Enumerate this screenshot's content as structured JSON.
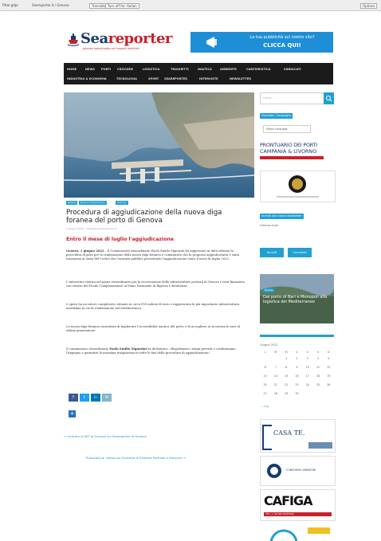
{
  "browser_bar": {
    "left_text": "Filter.gdpr",
    "middle_text": "Seareporter.it / Genova",
    "btn1": "Translate",
    "btn2": "Turn off for: Italian",
    "right_btn": "Options"
  },
  "logo": {
    "part1": "Sea",
    "part2": "reporter",
    "tagline": "giornale specializzato nei trasporti marittimi"
  },
  "banner": {
    "line1": "La tua pubblicità sul nostro sito?",
    "line2": "CLICCA QUI!"
  },
  "nav": {
    "row1": [
      "HOME",
      "NEWS",
      "PORTI",
      "CROCIERE",
      "LOGISTICA",
      "TRAGHETTI",
      "NAUTICA",
      "AMBIENTE",
      "CANTIERISTICA",
      "SINDACATI"
    ],
    "row2": [
      "INDUSTRIA & ECONOMIA",
      "TECNOLOGIA",
      "SPORT",
      "SEAREPORTER",
      "INTERVISTE",
      "NEWSLETTER"
    ]
  },
  "article": {
    "tags": [
      "Notizie",
      "Porti e infrastrutture",
      "Genova"
    ],
    "title": "Procedura di aggiudicazione della nuova diga foranea del porto di Genova",
    "meta": "2 Giugno 2022  •  Redazione Seareporter.it",
    "subtitle": "Entro il mese di luglio l'aggiudicazione",
    "p1_lead": "Genova, 1 giugno 2022",
    "p1": " – Il Commissario straordinario Paolo Emilio Signorini ha aggiornato in data odierna la procedura di gara per la realizzazione della nuova diga foranea e comunicato che la proposta aggiudicataria è stata trasmessa ai sensi del Codice dei Contratti pubblici prevedendo l'aggiudicazione entro il mese di luglio 2022.",
    "p2": "L'intervento rientra nel piano straordinario per la ricostruzione delle infrastrutture portuali di Genova e sarà finanziato con risorse del Fondo Complementare al Piano Nazionale di Ripresa e Resilienza.",
    "p3": "L'opera ha un valore complessivo stimato in circa 950 milioni di euro e rappresenta la più importante infrastruttura marittima in via di realizzazione nel Mediterraneo.",
    "p4": "La nuova diga foranea consentirà di migliorare l'accessibilità nautica del porto e di accogliere in sicurezza le navi di ultima generazione.",
    "p5_pre": "Il commissario straordinario ",
    "p5_name": "Paolo Emilio Signorini",
    "p5": " ha dichiarato: «Rispettiamo i tempi previsti e confermiamo l'impegno a garantire la massima trasparenza in tutte le fasi della procedura di aggiudicazione».",
    "share": [
      "f",
      "t",
      "in",
      "✉"
    ],
    "prev": "← Incontro al MIT di Genova sui Seareporter di Genova",
    "next": "Protocollo di intesa tra l'Autorità di Sistema Portuale e Ravenna →"
  },
  "sidebar": {
    "search_placeholder": "Cerca…",
    "translate_title": "Translate / Languages",
    "translate_select": "Select Language",
    "prontuario_line1": "PRONTUARIO DEI PORTI",
    "prontuario_line2": "CAMPANIA & LIVORNO",
    "newsletter_title": "Iscriviti alla nostra Newsletter",
    "newsletter_field": "Indirizzo email",
    "btn_subscribe": "Iscriviti",
    "btn_unsubscribe": "Cancellati",
    "featured_tag": "Notizie",
    "featured_title": "Dal porto di Bari e Monopoli alla logistica del Mediterraneo",
    "cal_title": "Giugno 2022",
    "cal_head": [
      "L",
      "M",
      "M",
      "G",
      "V",
      "S",
      "D"
    ],
    "cal_rows": [
      [
        "",
        "",
        "1",
        "2",
        "3",
        "4",
        "5"
      ],
      [
        "6",
        "7",
        "8",
        "9",
        "10",
        "11",
        "12"
      ],
      [
        "13",
        "14",
        "15",
        "16",
        "17",
        "18",
        "19"
      ],
      [
        "20",
        "21",
        "22",
        "23",
        "24",
        "25",
        "26"
      ],
      [
        "27",
        "28",
        "29",
        "30",
        "",
        "",
        ""
      ]
    ],
    "cal_prev": "« mag",
    "ad1": "CASA TE.",
    "ad2": "CONSORZIO ARMATORI",
    "ad3": "CAFIGA",
    "ad3_sub": "TEL. + 39 081 8293549"
  },
  "colors": {
    "accent": "#21a0d2",
    "brand_red": "#c8202a",
    "nav_bg": "#1b1b1b"
  }
}
